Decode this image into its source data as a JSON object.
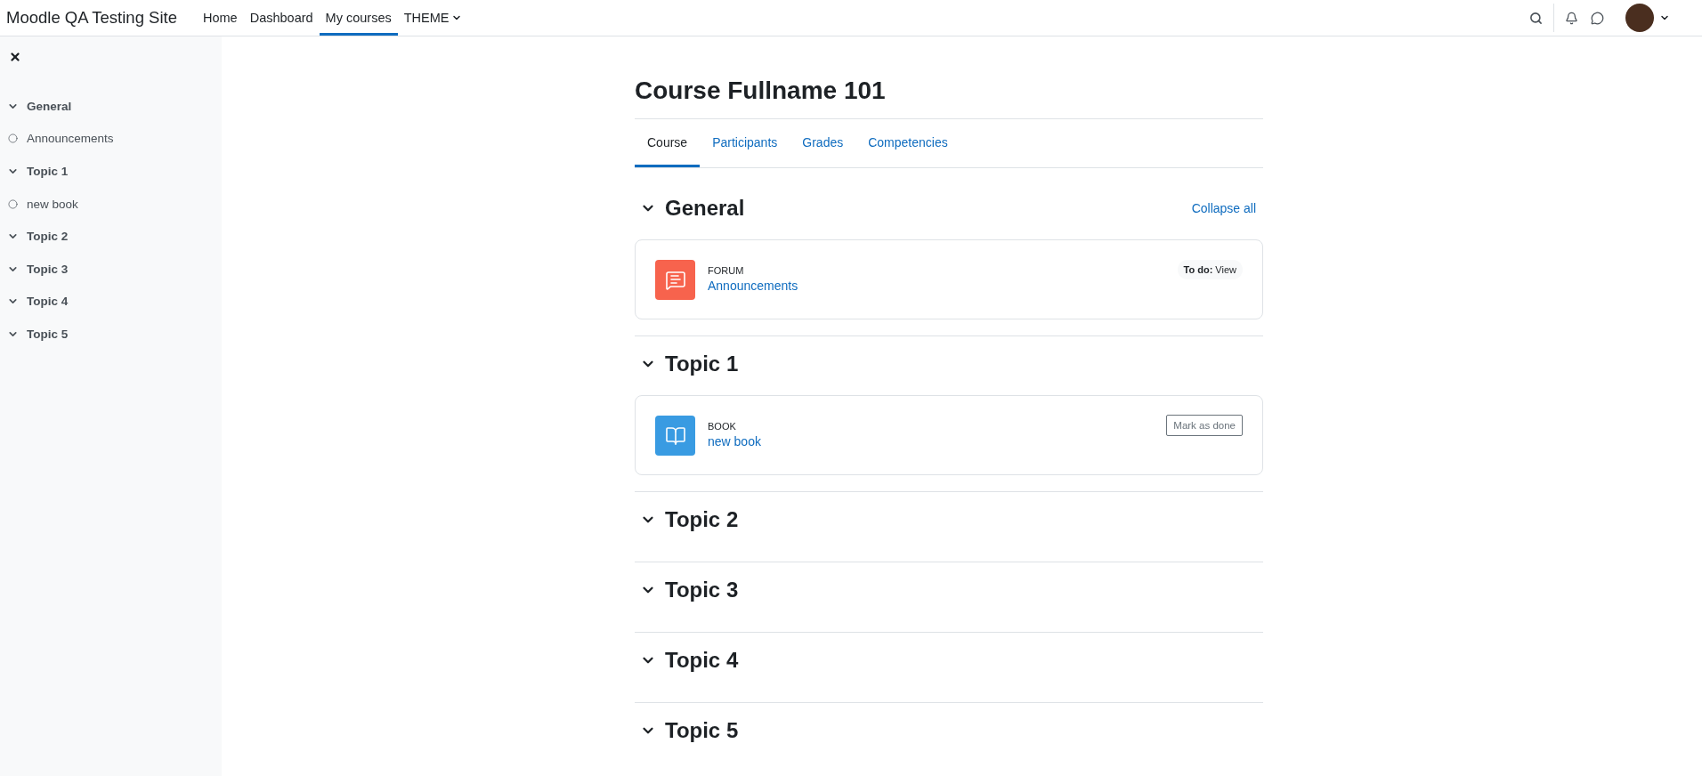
{
  "site_name": "Moodle QA Testing Site",
  "nav": [
    {
      "label": "Home",
      "selected": false,
      "kind": "link"
    },
    {
      "label": "Dashboard",
      "selected": false,
      "kind": "link"
    },
    {
      "label": "My courses",
      "selected": true,
      "kind": "link"
    },
    {
      "label": "THEME",
      "selected": false,
      "kind": "dropdown"
    }
  ],
  "sidebar": {
    "items": [
      {
        "label": "General",
        "kind": "section"
      },
      {
        "label": "Announcements",
        "kind": "activity"
      },
      {
        "label": "Topic 1",
        "kind": "section"
      },
      {
        "label": "new book",
        "kind": "activity"
      },
      {
        "label": "Topic 2",
        "kind": "section"
      },
      {
        "label": "Topic 3",
        "kind": "section"
      },
      {
        "label": "Topic 4",
        "kind": "section"
      },
      {
        "label": "Topic 5",
        "kind": "section"
      }
    ]
  },
  "course_title": "Course Fullname 101",
  "tabs": [
    {
      "label": "Course",
      "selected": true
    },
    {
      "label": "Participants",
      "selected": false
    },
    {
      "label": "Grades",
      "selected": false
    },
    {
      "label": "Competencies",
      "selected": false
    }
  ],
  "sections": [
    {
      "title": "General",
      "action": "Collapse all",
      "activities": [
        {
          "kind": "forum",
          "type_label": "FORUM",
          "name": "Announcements",
          "completion": {
            "kind": "badge",
            "text": "**To do:** View"
          }
        }
      ]
    },
    {
      "title": "Topic 1",
      "activities": [
        {
          "kind": "book",
          "type_label": "BOOK",
          "name": "new book",
          "completion": {
            "kind": "button",
            "text": "Mark as done"
          }
        }
      ]
    },
    {
      "title": "Topic 2"
    },
    {
      "title": "Topic 3"
    },
    {
      "title": "Topic 4"
    },
    {
      "title": "Topic 5"
    }
  ]
}
